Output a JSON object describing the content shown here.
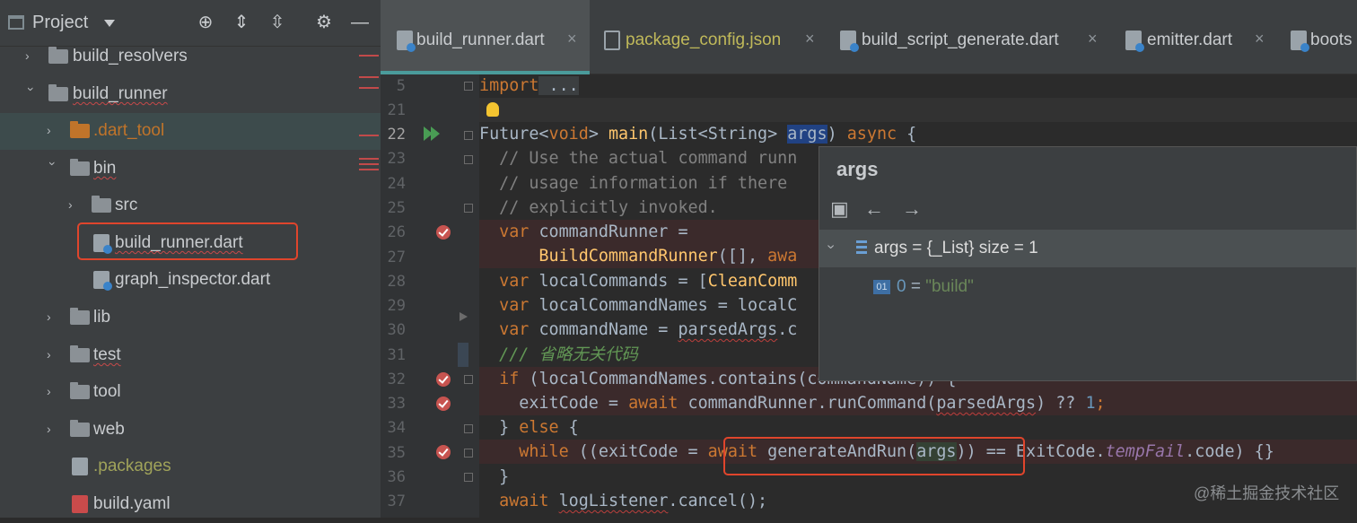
{
  "project_panel": {
    "title": "Project",
    "tree": [
      {
        "label": "build_resolvers",
        "kind": "folder",
        "expanded": false
      },
      {
        "label": "build_runner",
        "kind": "folder",
        "expanded": true
      },
      {
        "label": ".dart_tool",
        "kind": "folder",
        "expanded": false
      },
      {
        "label": "bin",
        "kind": "folder",
        "expanded": true
      },
      {
        "label": "src",
        "kind": "folder",
        "expanded": false
      },
      {
        "label": "build_runner.dart",
        "kind": "dart-file"
      },
      {
        "label": "graph_inspector.dart",
        "kind": "dart-file"
      },
      {
        "label": "lib",
        "kind": "folder",
        "expanded": false
      },
      {
        "label": "test",
        "kind": "folder",
        "expanded": false
      },
      {
        "label": "tool",
        "kind": "folder",
        "expanded": false
      },
      {
        "label": "web",
        "kind": "folder",
        "expanded": false
      },
      {
        "label": ".packages",
        "kind": "file"
      },
      {
        "label": "build.yaml",
        "kind": "yaml-file"
      }
    ]
  },
  "tabs": [
    {
      "label": "build_runner.dart",
      "active": true
    },
    {
      "label": "package_config.json",
      "active": false
    },
    {
      "label": "build_script_generate.dart",
      "active": false
    },
    {
      "label": "emitter.dart",
      "active": false
    },
    {
      "label": "boots",
      "active": false
    }
  ],
  "tab_close_glyph": "×",
  "editor": {
    "line_numbers": [
      "5",
      "21",
      "22",
      "23",
      "24",
      "25",
      "26",
      "27",
      "28",
      "29",
      "30",
      "31",
      "32",
      "33",
      "34",
      "35",
      "36",
      "37"
    ],
    "lines": {
      "l5_kw": "import",
      "l5_rest": " ...",
      "l22_a": "Future<",
      "l22_void": "void",
      "l22_b": "> ",
      "l22_main": "main",
      "l22_c": "(List<String> ",
      "l22_args": "args",
      "l22_d": ") ",
      "l22_async": "async",
      "l22_e": " {",
      "l23": "  // Use the actual command runn",
      "l24": "  // usage information if there",
      "l25": "  // explicitly invoked.",
      "l26_kw": "  var",
      "l26_rest": " commandRunner =",
      "l27_fn": "      BuildCommandRunner",
      "l27_rest": "([], ",
      "l27_kw": "awa",
      "l28_kw": "  var",
      "l28_rest": " localCommands = [",
      "l28_fn": "CleanComm",
      "l29_kw": "  var",
      "l29_rest": " localCommandNames = localC",
      "l30_kw": "  var",
      "l30_a": " commandName = ",
      "l30_sq": "parsedArgs",
      "l30_b": ".c",
      "l31": "  /// 省略无关代码",
      "l32_kw": "  if",
      "l32_rest": " (localCommandNames.contains(commandName)) {",
      "l33_a": "    exitCode = ",
      "l33_kw": "await",
      "l33_b": " commandRunner.runCommand(",
      "l33_sq": "parsedArgs",
      "l33_c": ") ?? ",
      "l33_num": "1",
      "l33_d": ";",
      "l34_a": "  } ",
      "l34_kw": "else",
      "l34_b": " {",
      "l35_kw": "    while",
      "l35_a": " ((exitCode = ",
      "l35_await": "await",
      "l35_b": " generateAndRun(",
      "l35_args": "args",
      "l35_c": ")) == ExitCode.",
      "l35_it": "tempFail",
      "l35_d": ".code) {}",
      "l36": "  }",
      "l37_kw": "  await",
      "l37_a": " ",
      "l37_sq": "logListener",
      "l37_b": ".cancel();"
    }
  },
  "debug_popup": {
    "title": "args",
    "row1": "args = {_List} size = 1",
    "row2_index": "0",
    "row2_eq": " = ",
    "row2_value": "\"build\"",
    "index_badge": "01"
  },
  "watermark": "@稀土掘金技术社区",
  "colors": {
    "breakpoint": "#c75450",
    "annotation_box": "#e0452c",
    "active_tab_underline": "#4a9b9b"
  }
}
